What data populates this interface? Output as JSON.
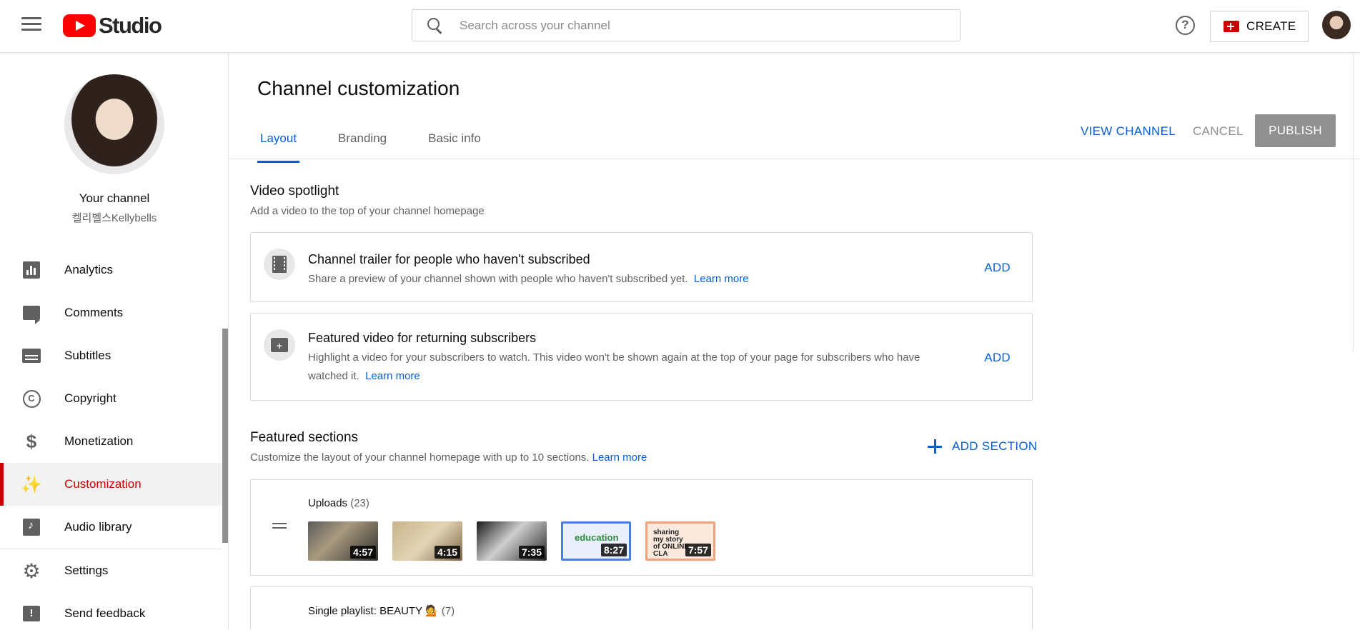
{
  "header": {
    "logo_text": "Studio",
    "search_placeholder": "Search across your channel",
    "help_glyph": "?",
    "create_label": "CREATE"
  },
  "sidebar": {
    "your_channel": "Your channel",
    "channel_name": "켈리벨스Kellybells",
    "items": [
      {
        "label": "Analytics",
        "icon": "analytics-icon"
      },
      {
        "label": "Comments",
        "icon": "comments-icon"
      },
      {
        "label": "Subtitles",
        "icon": "subtitles-icon"
      },
      {
        "label": "Copyright",
        "icon": "copyright-icon"
      },
      {
        "label": "Monetization",
        "icon": "dollar-icon"
      },
      {
        "label": "Customization",
        "icon": "magic-wand-icon",
        "active": true
      },
      {
        "label": "Audio library",
        "icon": "audio-library-icon"
      },
      {
        "label": "Settings",
        "icon": "gear-icon"
      },
      {
        "label": "Send feedback",
        "icon": "feedback-icon"
      }
    ]
  },
  "main": {
    "title": "Channel customization",
    "tabs": [
      {
        "label": "Layout",
        "active": true
      },
      {
        "label": "Branding"
      },
      {
        "label": "Basic info"
      }
    ],
    "actions": {
      "view_channel": "VIEW CHANNEL",
      "cancel": "CANCEL",
      "publish": "PUBLISH"
    },
    "video_spotlight": {
      "heading": "Video spotlight",
      "subheading": "Add a video to the top of your channel homepage",
      "trailer": {
        "title": "Channel trailer for people who haven't subscribed",
        "desc": "Share a preview of your channel shown with people who haven't subscribed yet.",
        "learn_more": "Learn more",
        "add": "ADD"
      },
      "featured": {
        "title": "Featured video for returning subscribers",
        "desc_line1": "Highlight a video for your subscribers to watch. This video won't be shown again at the top of your page for subscribers who have",
        "desc_line2": "watched it.",
        "learn_more": "Learn more",
        "add": "ADD"
      }
    },
    "featured_sections": {
      "heading": "Featured sections",
      "subheading": "Customize the layout of your channel homepage with up to 10 sections.",
      "learn_more": "Learn more",
      "add_section": "ADD SECTION",
      "uploads": {
        "title": "Uploads",
        "count": "(23)",
        "thumbnails": [
          {
            "duration": "4:57"
          },
          {
            "duration": "4:15"
          },
          {
            "duration": "7:35"
          },
          {
            "duration": "8:27",
            "text": "education"
          },
          {
            "duration": "7:57",
            "text": "sharing my story of ONLINE CLA"
          }
        ]
      },
      "playlist": {
        "label": "Single playlist:",
        "name": "BEAUTY 💁",
        "count": "(7)"
      }
    }
  },
  "colors": {
    "brand_red": "#ff0000",
    "accent_blue": "#065fd4",
    "active_red": "#cc0000",
    "disabled_gray": "#909090"
  }
}
